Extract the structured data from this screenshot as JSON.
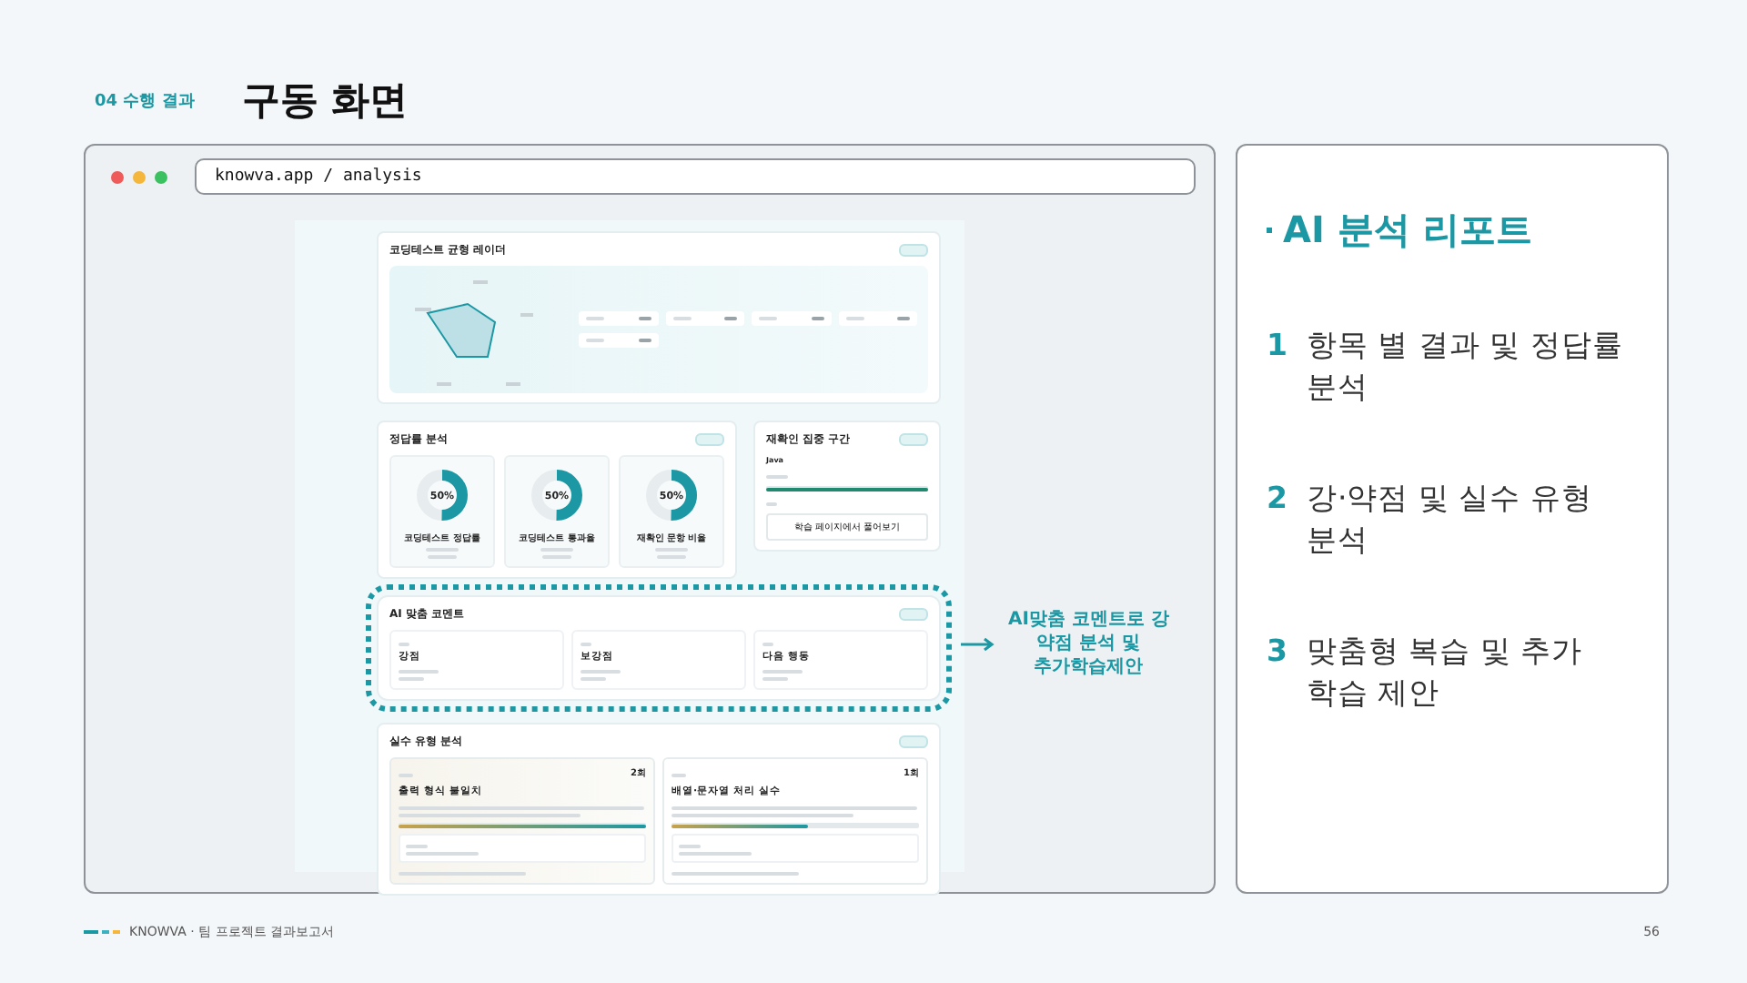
{
  "header": {
    "section": "04 수행 결과",
    "title": "구동 화면"
  },
  "browser": {
    "url": "knowva.app / analysis"
  },
  "app": {
    "radar": {
      "title": "코딩테스트 균형 레이더"
    },
    "accuracy": {
      "title": "정답률 분석",
      "donuts": [
        {
          "reading": "50%",
          "level": 0.5,
          "label": "코딩테스트 정답률"
        },
        {
          "reading": "50%",
          "level": 0.5,
          "label": "코딩테스트 통과율"
        },
        {
          "reading": "50%",
          "level": 0.5,
          "label": "재확인 문항 비율"
        }
      ]
    },
    "focus": {
      "title": "재확인 집중 구간",
      "topic": "Java",
      "level": 1.0,
      "action": "학습 페이지에서 풀어보기"
    },
    "comment": {
      "title": "AI 맞춤 코멘트",
      "columns": [
        {
          "heading": "강점"
        },
        {
          "heading": "보강점"
        },
        {
          "heading": "다음 행동"
        }
      ]
    },
    "mistakes": {
      "title": "실수 유형 분석",
      "cards": [
        {
          "count": "2회",
          "title": "출력 형식 불일치",
          "level": 1.0
        },
        {
          "count": "1회",
          "title": "배열·문자열 처리 실수",
          "level": 0.55
        }
      ]
    }
  },
  "callout": "AI맞춤 코멘트로 강\n약점 분석 및\n추가학습제안",
  "report": {
    "title": "AI 분석 리포트",
    "items": [
      {
        "number": "1",
        "text": "항목 별 결과 및 정답률 분석"
      },
      {
        "number": "2",
        "text": "강·약점 및 실수 유형 분석"
      },
      {
        "number": "3",
        "text": "맞춤형 복습 및 추가 학습 제안"
      }
    ]
  },
  "footer": {
    "brand": "KNOWVA · 팀 프로젝트 결과보고서",
    "page": "56"
  }
}
